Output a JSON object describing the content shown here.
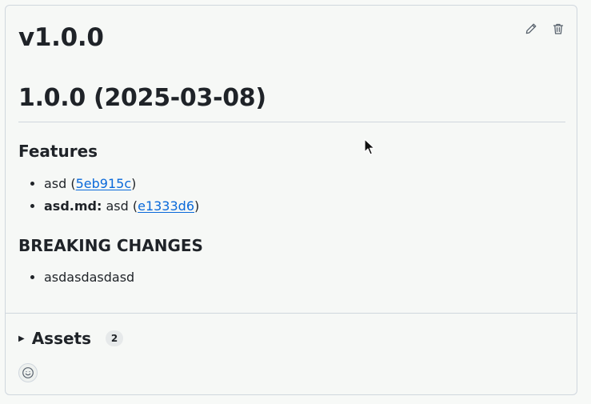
{
  "release": {
    "tag": "v1.0.0",
    "version_heading": "1.0.0 (2025-03-08)",
    "edit_icon": "pencil-icon",
    "delete_icon": "trash-icon"
  },
  "features": {
    "heading": "Features",
    "items": [
      {
        "prefix": "",
        "text_before": "asd (",
        "commit": "5eb915c",
        "text_after": ")"
      },
      {
        "prefix": "asd.md:",
        "text_before": " asd (",
        "commit": "e1333d6",
        "text_after": ")"
      }
    ]
  },
  "breaking": {
    "heading": "BREAKING CHANGES",
    "items": [
      "asdasdasdasd"
    ]
  },
  "assets": {
    "label": "Assets",
    "count": "2",
    "toggle_icon": "triangle-right-icon"
  },
  "reactions": {
    "icon": "smiley-icon"
  },
  "colors": {
    "link": "#0969da",
    "border": "#d0d7de",
    "text": "#1f2328"
  }
}
